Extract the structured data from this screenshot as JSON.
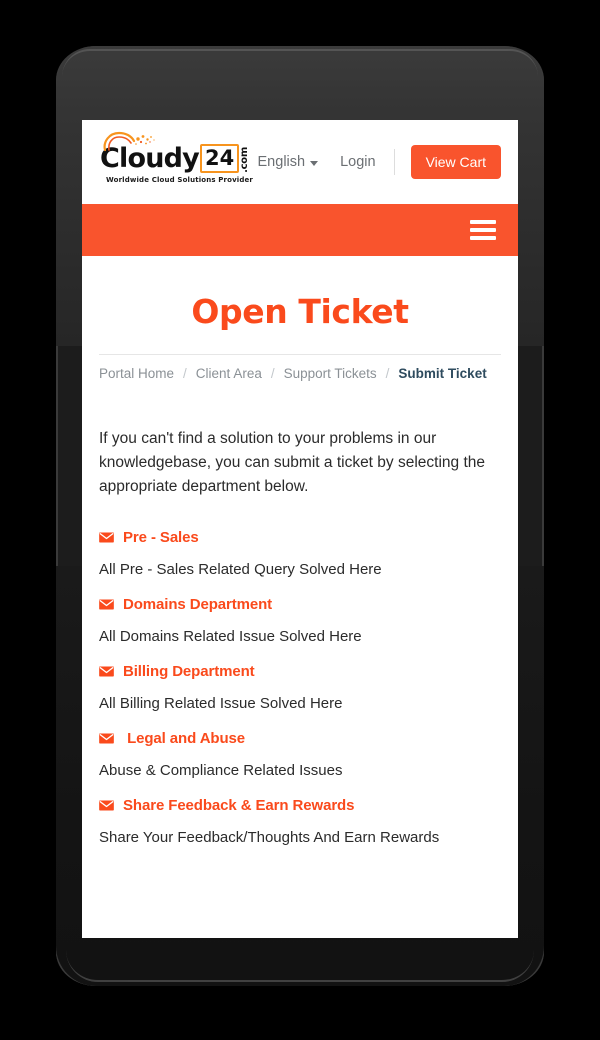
{
  "device": {
    "frame_name": "smartphone-mockup",
    "camera": "front-camera",
    "speaker": "earpiece-speaker"
  },
  "header": {
    "logo": {
      "word": "Cloudy",
      "badge": "24",
      "tld": ".com",
      "tagline": "Worldwide Cloud Solutions Provider"
    },
    "language_label": "English",
    "login_label": "Login",
    "view_cart_label": "View Cart"
  },
  "menu_bar": {
    "toggle_label": "Menu"
  },
  "page": {
    "title": "Open Ticket",
    "breadcrumb": [
      {
        "label": "Portal Home",
        "active": false
      },
      {
        "label": "Client Area",
        "active": false
      },
      {
        "label": "Support Tickets",
        "active": false
      },
      {
        "label": "Submit Ticket",
        "active": true
      }
    ],
    "breadcrumb_separator": "/",
    "intro": "If you can't find a solution to your problems in our knowledgebase, you can submit a ticket by selecting the appropriate department below.",
    "departments": [
      {
        "name": "Pre - Sales",
        "description": "All Pre - Sales Related Query Solved Here"
      },
      {
        "name": "Domains Department",
        "description": "All Domains Related Issue Solved Here"
      },
      {
        "name": "Billing Department",
        "description": "All Billing Related Issue Solved Here"
      },
      {
        "name": " Legal and Abuse",
        "description": "Abuse & Compliance Related Issues"
      },
      {
        "name": "Share Feedback & Earn Rewards",
        "description": "Share Your Feedback/Thoughts And Earn Rewards"
      }
    ]
  },
  "colors": {
    "brand_orange": "#F9542D",
    "title_orange": "#FA4A1C",
    "logo_badge_border": "#F7941E",
    "breadcrumb_active": "#2E4B5E",
    "breadcrumb_muted": "#8B9196",
    "body_text": "#2B2B2B",
    "page_background": "#000000",
    "screen_background": "#FFFFFF"
  }
}
